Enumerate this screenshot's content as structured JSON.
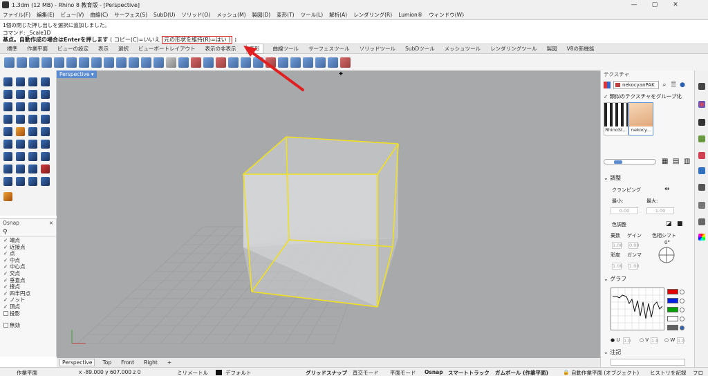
{
  "window": {
    "title": "1.3dm (12 MB) - Rhino 8 教育版 - [Perspective]",
    "controls": [
      "—",
      "▢",
      "✕"
    ]
  },
  "menu": [
    "ファイル(F)",
    "編集(E)",
    "ビュー(V)",
    "曲線(C)",
    "サーフェス(S)",
    "SubD(U)",
    "ソリッド(O)",
    "メッシュ(M)",
    "製図(D)",
    "変形(T)",
    "ツール(L)",
    "解析(A)",
    "レンダリング(R)",
    "Lumion®",
    "ウィンドウ(W)"
  ],
  "command": {
    "line1": "1個の閉じた押し出しを選択に追加しました。",
    "line2": "コマンド: _Scale1D",
    "line3_prefix": "基点。自動作成の場合はEnterを押します",
    "line3_option1": "( コピー(C)=いいえ",
    "line3_option2": "元の形状を維持(R)=はい )",
    "line3_suffix": ":"
  },
  "tabs": [
    "標準",
    "作業平面",
    "ビューの設定",
    "表示",
    "選択",
    "ビューポートレイアウト",
    "表示の非表示",
    "変形",
    "曲線ツール",
    "サーフェスツール",
    "ソリッドツール",
    "SubDツール",
    "メッシュツール",
    "レンダリングツール",
    "製図",
    "V8の新機能"
  ],
  "active_tab": "変形",
  "viewport": {
    "name": "Perspective",
    "tabs": [
      "Perspective",
      "Top",
      "Front",
      "Right"
    ],
    "add_tab": "+",
    "highlight_color": "#f0e020"
  },
  "osnap": {
    "title": "Osnap",
    "items": [
      {
        "label": "端点",
        "checked": true
      },
      {
        "label": "近接点",
        "checked": true
      },
      {
        "label": "点",
        "checked": true
      },
      {
        "label": "中点",
        "checked": true
      },
      {
        "label": "中心点",
        "checked": true
      },
      {
        "label": "交点",
        "checked": true
      },
      {
        "label": "垂直点",
        "checked": true
      },
      {
        "label": "接点",
        "checked": true
      },
      {
        "label": "四半円点",
        "checked": true
      },
      {
        "label": "ノット",
        "checked": true
      },
      {
        "label": "頂点",
        "checked": true
      },
      {
        "label": "投影",
        "checked": false
      },
      {
        "label": "無効",
        "checked": false
      }
    ]
  },
  "texture_panel": {
    "title": "テクスチャ",
    "current": "nekocyanPAK",
    "group_label": "類似のテクスチャをグループ化",
    "thumbnails": [
      "RhinoSt...",
      "nekocy..."
    ],
    "adjust_section": "調整",
    "clamping": "クランピング",
    "min_label": "最小:",
    "max_label": "最大:",
    "min_value": "0.00",
    "max_value": "1.00",
    "color_adjust": "色調整",
    "multiply": "乗数",
    "gain": "ゲイン",
    "hue_shift": "色相シフト",
    "hue_value": "0°",
    "saturation": "彩度",
    "gamma": "ガンマ",
    "v1": "1.00",
    "v2": "0.00",
    "v3": "1.00",
    "v4": "1.00",
    "graph_section": "グラフ",
    "graph_colors": [
      "#e00000",
      "#0020e0",
      "#00a000",
      "#ffffff",
      "#606060"
    ],
    "uvw": [
      "U",
      "V",
      "W"
    ],
    "uvw_value": "1.0",
    "notes_section": "注記"
  },
  "status": {
    "plane": "作業平面",
    "coords": "x -89.000  y 607.000  z 0",
    "units": "ミリメートル",
    "layer": "デフォルト",
    "grid_snap": "グリッドスナップ",
    "ortho": "直交モード",
    "planar": "平面モード",
    "osnap": "Osnap",
    "smart_track": "スマートトラック",
    "gumball": "ガムボール (作業平面)",
    "auto_plane": "自動作業平面 (オブジェクト)",
    "history": "ヒストリを記録",
    "filter": "フロ"
  }
}
